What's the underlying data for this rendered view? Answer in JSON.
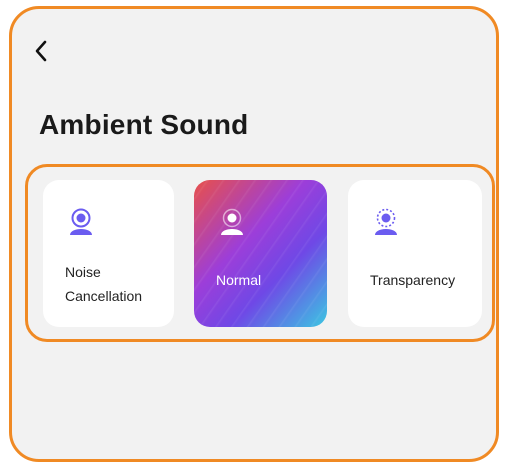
{
  "header": {
    "back_icon": "chevron-left-icon",
    "title": "Ambient Sound"
  },
  "colors": {
    "highlight_border": "#f08a24",
    "icon_purple": "#6b5cf0",
    "selected_gradient": [
      "#e8504a",
      "#9c3ed9",
      "#6f48e6",
      "#3bc7e2"
    ],
    "background": "#f2f2f2"
  },
  "modes": [
    {
      "label_line1": "Noise",
      "label_line2": "Cancellation",
      "icon": "noise-cancellation-icon",
      "selected": false
    },
    {
      "label_line1": "Normal",
      "icon": "normal-mode-icon",
      "selected": true
    },
    {
      "label_line1": "Transparency",
      "icon": "transparency-icon",
      "selected": false
    }
  ]
}
